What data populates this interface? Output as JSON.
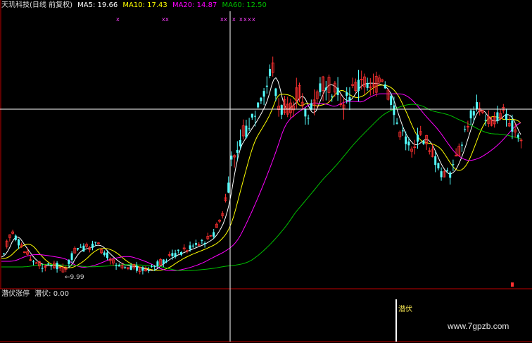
{
  "header": {
    "title": "天玑科技(日线 前复权)",
    "ma5": "MA5: 19.66",
    "ma10": "MA10: 17.43",
    "ma20": "MA20: 14.87",
    "ma60": "MA60: 12.50"
  },
  "sub_header": {
    "label": "潜伏涨停",
    "value": "潜伏: 0.00"
  },
  "annotations": {
    "low_label": "9.99",
    "signal_label": "潜伏",
    "watermark": "www.7gpzb.com"
  },
  "colors": {
    "up": "#ff3030",
    "down": "#54ffff",
    "ma5": "#ffffff",
    "ma10": "#ffff00",
    "ma20": "#ff00ff",
    "ma60": "#00c000",
    "axis": "#c00000",
    "crosshair": "#ffffff"
  },
  "chart_data": {
    "type": "candlestick",
    "markers": {
      "symbol": "x",
      "count": 10
    }
  }
}
